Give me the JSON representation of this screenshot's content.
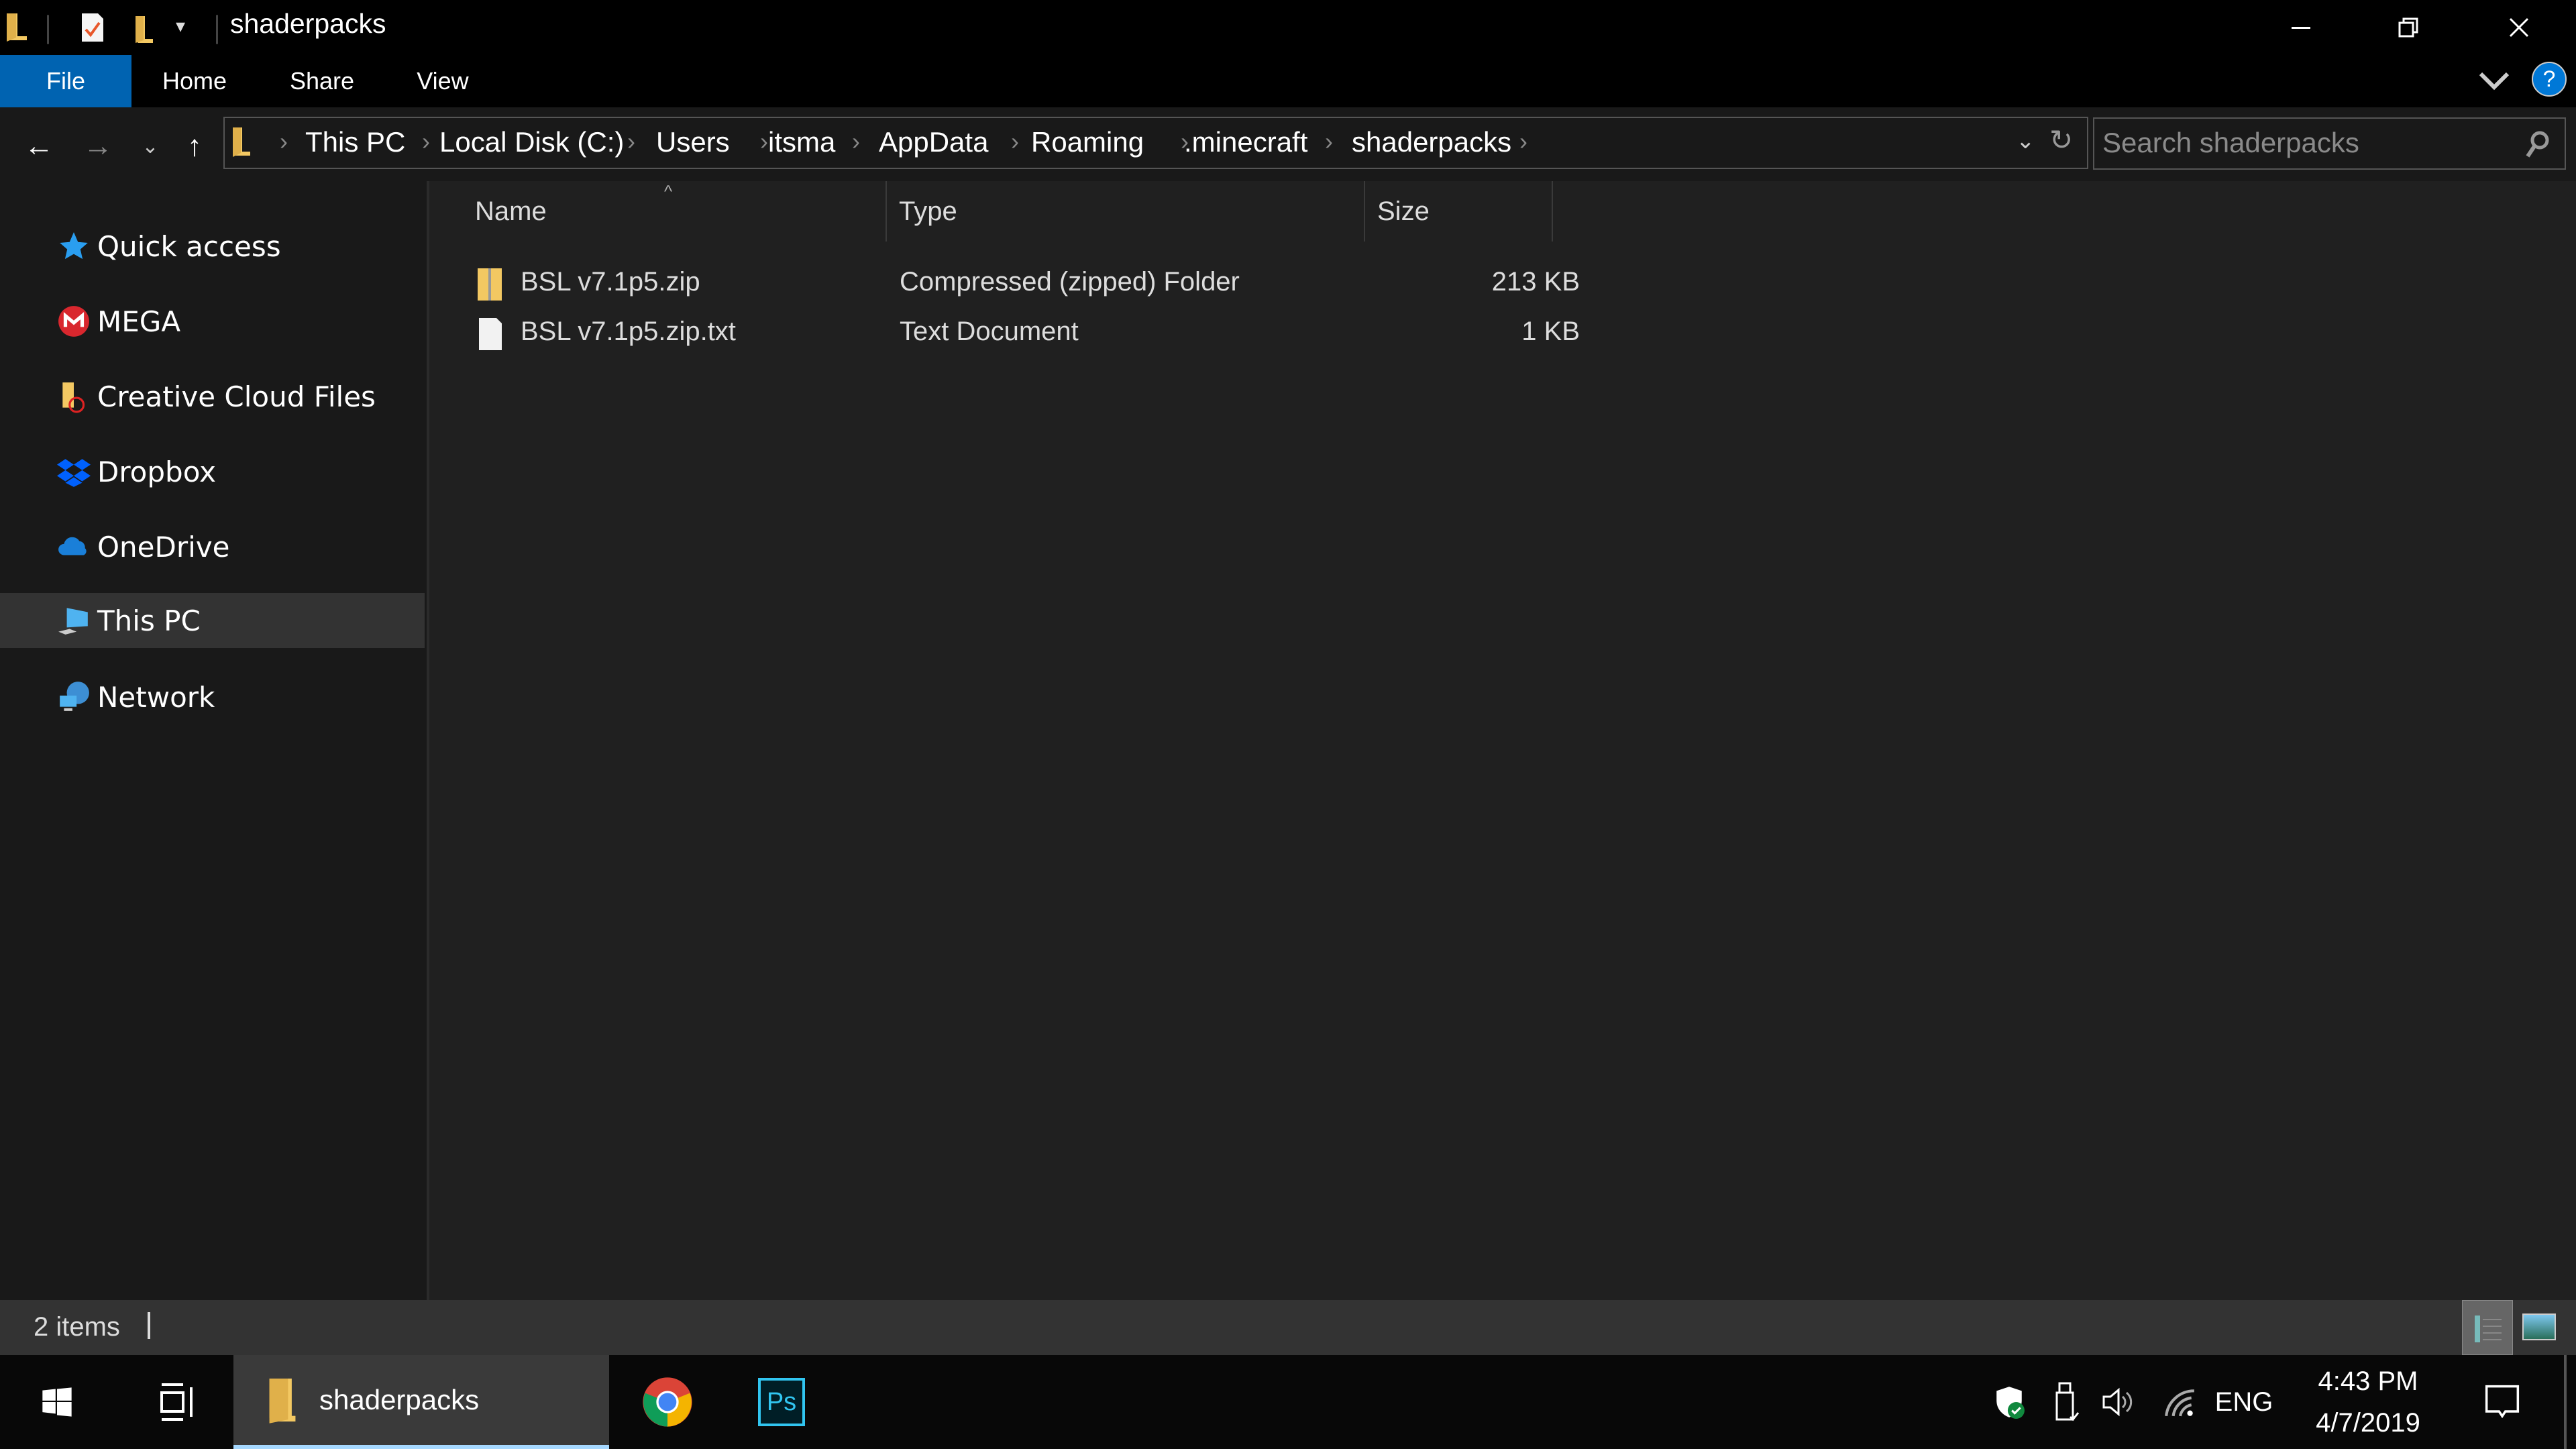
{
  "window": {
    "title": "shaderpacks",
    "quick_access_toolbar": [
      "folder-icon",
      "properties-icon",
      "new-folder-icon",
      "customize-dropdown-icon"
    ],
    "controls": {
      "minimize": "minimize-icon",
      "restore": "restore-icon",
      "close": "close-icon"
    }
  },
  "ribbon": {
    "tabs": [
      {
        "label": "File",
        "active": true
      },
      {
        "label": "Home"
      },
      {
        "label": "Share"
      },
      {
        "label": "View"
      }
    ],
    "expand_icon": "chevron-down-icon",
    "help_label": "?"
  },
  "navigation": {
    "back": "back-arrow-icon",
    "forward": "forward-arrow-icon",
    "recent": "chevron-down-icon",
    "up": "up-arrow-icon"
  },
  "address": {
    "crumbs": [
      "This PC",
      "Local Disk (C:)",
      "Users",
      "itsma",
      "AppData",
      "Roaming",
      ".minecraft",
      "shaderpacks"
    ],
    "refresh_icon": "refresh-icon"
  },
  "search": {
    "placeholder": "Search shaderpacks"
  },
  "sidebar": {
    "items": [
      {
        "label": "Quick access",
        "icon": "star-icon"
      },
      {
        "label": "MEGA",
        "icon": "mega-icon"
      },
      {
        "label": "Creative Cloud Files",
        "icon": "creative-cloud-folder-icon"
      },
      {
        "label": "Dropbox",
        "icon": "dropbox-icon"
      },
      {
        "label": "OneDrive",
        "icon": "onedrive-icon"
      },
      {
        "label": "This PC",
        "icon": "computer-icon",
        "selected": true
      },
      {
        "label": "Network",
        "icon": "network-icon"
      }
    ]
  },
  "files": {
    "columns": [
      "Name",
      "Type",
      "Size"
    ],
    "sort_column": "Name",
    "rows": [
      {
        "name": "BSL v7.1p5.zip",
        "type": "Compressed (zipped) Folder",
        "size": "213 KB",
        "icon": "zip-folder-icon"
      },
      {
        "name": "BSL v7.1p5.zip.txt",
        "type": "Text Document",
        "size": "1 KB",
        "icon": "text-document-icon"
      }
    ]
  },
  "status": {
    "item_count": "2 items"
  },
  "taskbar": {
    "apps": [
      {
        "label": "shaderpacks",
        "icon": "file-explorer-icon",
        "active": true
      },
      {
        "label": "",
        "icon": "chrome-icon"
      },
      {
        "label": "Ps",
        "icon": "photoshop-icon"
      }
    ],
    "tray": {
      "language": "ENG",
      "time": "4:43 PM",
      "date": "4/7/2019"
    }
  },
  "colors": {
    "accent": "#0063b1",
    "background": "#202020",
    "sidebar": "#191919",
    "selected": "#333333"
  }
}
